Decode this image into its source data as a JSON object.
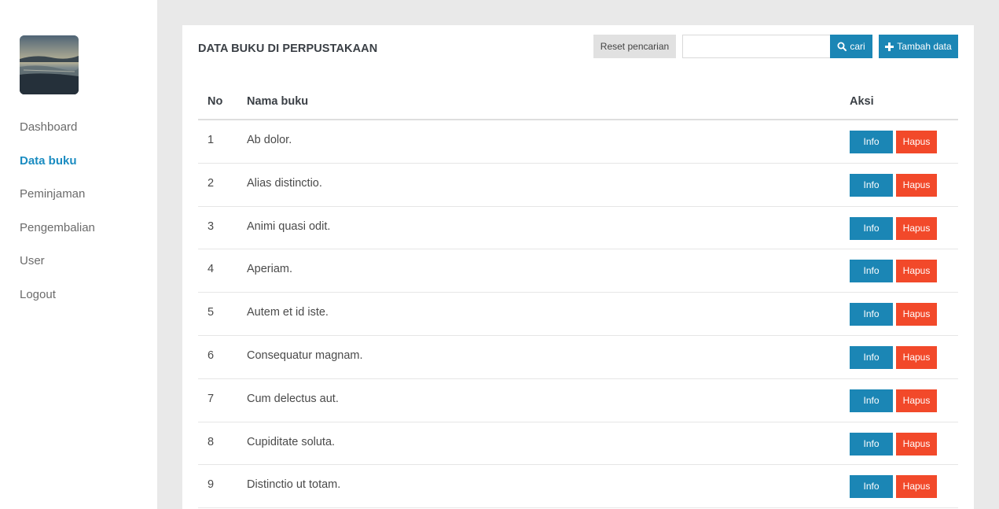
{
  "sidebar": {
    "avatar_alt": "",
    "items": [
      {
        "label": "Dashboard",
        "active": false
      },
      {
        "label": "Data buku",
        "active": true
      },
      {
        "label": "Peminjaman",
        "active": false
      },
      {
        "label": "Pengembalian",
        "active": false
      },
      {
        "label": "User",
        "active": false
      },
      {
        "label": "Logout",
        "active": false
      }
    ]
  },
  "header": {
    "title": "DATA BUKU DI PERPUSTAKAAN",
    "reset_label": "Reset pencarian",
    "search_value": "",
    "search_placeholder": "",
    "search_label": "cari",
    "search_icon": "search-icon",
    "add_label": "Tambah data",
    "add_icon": "plus-icon"
  },
  "table": {
    "columns": [
      "No",
      "Nama buku",
      "Aksi"
    ],
    "rows": [
      {
        "no": "1",
        "name": "Ab dolor.",
        "info": "Info",
        "hapus": "Hapus"
      },
      {
        "no": "2",
        "name": "Alias distinctio.",
        "info": "Info",
        "hapus": "Hapus"
      },
      {
        "no": "3",
        "name": "Animi quasi odit.",
        "info": "Info",
        "hapus": "Hapus"
      },
      {
        "no": "4",
        "name": "Aperiam.",
        "info": "Info",
        "hapus": "Hapus"
      },
      {
        "no": "5",
        "name": "Autem et id iste.",
        "info": "Info",
        "hapus": "Hapus"
      },
      {
        "no": "6",
        "name": "Consequatur magnam.",
        "info": "Info",
        "hapus": "Hapus"
      },
      {
        "no": "7",
        "name": "Cum delectus aut.",
        "info": "Info",
        "hapus": "Hapus"
      },
      {
        "no": "8",
        "name": "Cupiditate soluta.",
        "info": "Info",
        "hapus": "Hapus"
      },
      {
        "no": "9",
        "name": "Distinctio ut totam.",
        "info": "Info",
        "hapus": "Hapus"
      }
    ]
  },
  "colors": {
    "accent": "#1b86b5",
    "danger": "#f2492a",
    "nav_active": "#1b8cc1",
    "background": "#e9e9e9"
  }
}
